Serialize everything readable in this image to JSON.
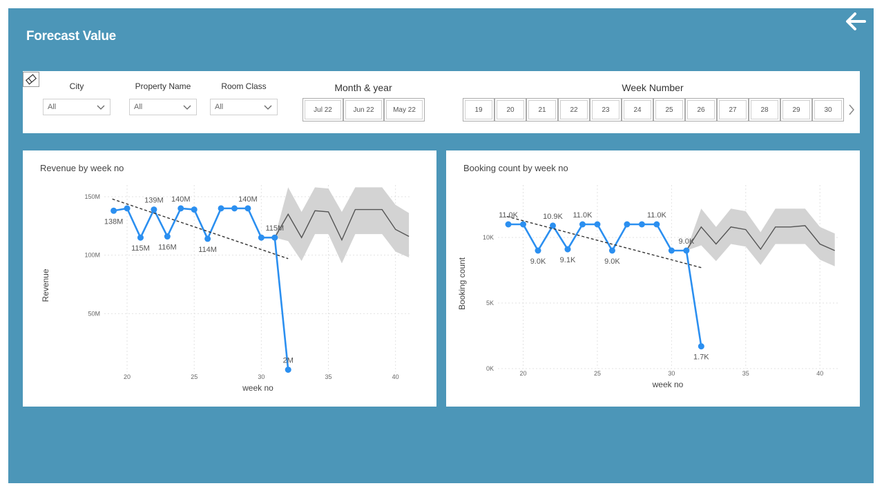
{
  "page": {
    "title": "Forecast Value"
  },
  "filters": {
    "city": {
      "label": "City",
      "value": "All"
    },
    "property": {
      "label": "Property Name",
      "value": "All"
    },
    "room": {
      "label": "Room Class",
      "value": "All"
    },
    "month": {
      "label": "Month & year",
      "options": [
        "Jul 22",
        "Jun 22",
        "May 22"
      ]
    },
    "week": {
      "label": "Week Number",
      "options": [
        "19",
        "20",
        "21",
        "22",
        "23",
        "24",
        "25",
        "26",
        "27",
        "28",
        "29",
        "30"
      ]
    }
  },
  "colors": {
    "actual": "#2b8ff0",
    "forecast": "#555555",
    "band": "#d3d3d3",
    "canvas": "#4c96b8"
  },
  "icons": {
    "back": "arrow-left-icon",
    "eraser": "eraser-icon",
    "next": "chevron-right-icon"
  },
  "chart_data": [
    {
      "type": "line",
      "title": "Revenue by week no",
      "xlabel": "week no",
      "ylabel": "Revenue",
      "ylim": [
        0,
        160000000
      ],
      "xlim": [
        18.3,
        41.2
      ],
      "yticks": [
        {
          "v": 50000000,
          "label": "50M"
        },
        {
          "v": 100000000,
          "label": "100M"
        },
        {
          "v": 150000000,
          "label": "150M"
        }
      ],
      "xticks": [
        20,
        25,
        30,
        35,
        40
      ],
      "grid": true,
      "series": [
        {
          "role": "actual",
          "x": [
            19,
            20,
            21,
            22,
            23,
            24,
            25,
            26,
            27,
            28,
            29,
            30,
            31,
            32
          ],
          "y": [
            138000000,
            140000000,
            115000000,
            139000000,
            116000000,
            140000000,
            139000000,
            114000000,
            140000000,
            140000000,
            140000000,
            115000000,
            115000000,
            2000000
          ]
        },
        {
          "role": "forecast",
          "x": [
            31,
            32,
            33,
            34,
            35,
            36,
            37,
            38,
            39,
            40,
            41
          ],
          "y": [
            115000000,
            135000000,
            115000000,
            138000000,
            137000000,
            113000000,
            139000000,
            139000000,
            139000000,
            122000000,
            116000000
          ],
          "lower": [
            115000000,
            112000000,
            95000000,
            118000000,
            118000000,
            93000000,
            118000000,
            118000000,
            118000000,
            103000000,
            98000000
          ],
          "upper": [
            115000000,
            158000000,
            137000000,
            158000000,
            157000000,
            137000000,
            158000000,
            158000000,
            158000000,
            143000000,
            136000000
          ]
        },
        {
          "role": "trend",
          "x": [
            18.9,
            32
          ],
          "y": [
            148000000,
            97000000
          ]
        }
      ],
      "labels": [
        {
          "x": 19,
          "y": 138000000,
          "text": "138M",
          "pos": "below"
        },
        {
          "x": 21,
          "y": 115000000,
          "text": "115M",
          "pos": "below"
        },
        {
          "x": 22,
          "y": 139000000,
          "text": "139M",
          "pos": "above"
        },
        {
          "x": 23,
          "y": 116000000,
          "text": "116M",
          "pos": "below"
        },
        {
          "x": 24,
          "y": 140000000,
          "text": "140M",
          "pos": "above"
        },
        {
          "x": 26,
          "y": 114000000,
          "text": "114M",
          "pos": "below"
        },
        {
          "x": 29,
          "y": 140000000,
          "text": "140M",
          "pos": "above"
        },
        {
          "x": 31,
          "y": 115000000,
          "text": "115M",
          "pos": "above"
        },
        {
          "x": 32,
          "y": 2000000,
          "text": "2M",
          "pos": "above"
        }
      ]
    },
    {
      "type": "line",
      "title": "Booking count by week no",
      "xlabel": "week no",
      "ylabel": "Booking count",
      "ylim": [
        0,
        14000
      ],
      "xlim": [
        18.3,
        41.2
      ],
      "yticks": [
        {
          "v": 0,
          "label": "0K"
        },
        {
          "v": 5000,
          "label": "5K"
        },
        {
          "v": 10000,
          "label": "10K"
        }
      ],
      "xticks": [
        20,
        25,
        30,
        35,
        40
      ],
      "grid": true,
      "series": [
        {
          "role": "actual",
          "x": [
            19,
            20,
            21,
            22,
            23,
            24,
            25,
            26,
            27,
            28,
            29,
            30,
            31,
            32
          ],
          "y": [
            11000,
            11000,
            9000,
            10900,
            9100,
            11000,
            11000,
            9000,
            11000,
            11000,
            11000,
            9000,
            9000,
            1700
          ]
        },
        {
          "role": "forecast",
          "x": [
            31,
            32,
            33,
            34,
            35,
            36,
            37,
            38,
            39,
            40,
            41
          ],
          "y": [
            9000,
            10800,
            9500,
            10800,
            10600,
            9100,
            10800,
            10800,
            10900,
            9500,
            9000
          ],
          "lower": [
            9000,
            9400,
            8200,
            9500,
            9300,
            7900,
            9500,
            9500,
            9500,
            8300,
            7800
          ],
          "upper": [
            9000,
            12200,
            10800,
            12200,
            12000,
            10400,
            12200,
            12200,
            12200,
            10800,
            10300
          ]
        },
        {
          "role": "trend",
          "x": [
            18.9,
            32
          ],
          "y": [
            11600,
            7700
          ]
        }
      ],
      "labels": [
        {
          "x": 19,
          "y": 11000,
          "text": "11.0K",
          "pos": "above"
        },
        {
          "x": 21,
          "y": 9000,
          "text": "9.0K",
          "pos": "below"
        },
        {
          "x": 22,
          "y": 10900,
          "text": "10.9K",
          "pos": "above"
        },
        {
          "x": 23,
          "y": 9100,
          "text": "9.1K",
          "pos": "below"
        },
        {
          "x": 24,
          "y": 11000,
          "text": "11.0K",
          "pos": "above"
        },
        {
          "x": 26,
          "y": 9000,
          "text": "9.0K",
          "pos": "below"
        },
        {
          "x": 29,
          "y": 11000,
          "text": "11.0K",
          "pos": "above"
        },
        {
          "x": 31,
          "y": 9000,
          "text": "9.0K",
          "pos": "above"
        },
        {
          "x": 32,
          "y": 1700,
          "text": "1.7K",
          "pos": "below"
        }
      ]
    }
  ]
}
